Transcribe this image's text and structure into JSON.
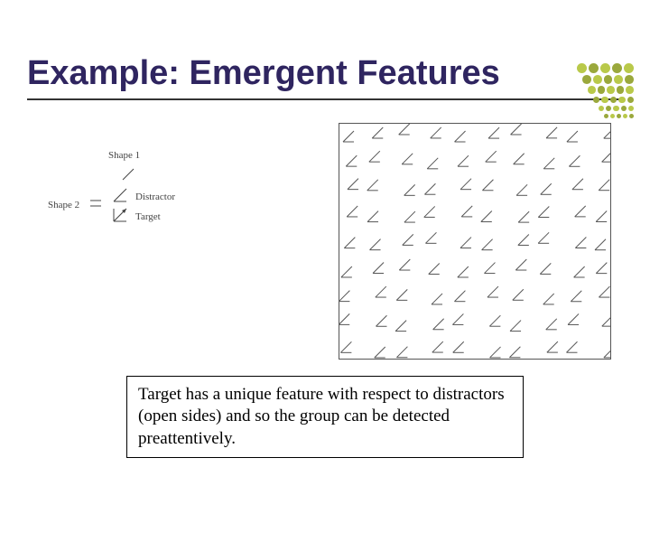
{
  "title": "Example: Emergent Features",
  "legend": {
    "shape1": "Shape 1",
    "shape2": "Shape 2",
    "distractor": "Distractor",
    "target": "Target"
  },
  "caption": "Target has a unique feature with respect to distractors (open sides) and so the group can be detected preattentively.",
  "palette": {
    "title": "#2f2560",
    "accent": "#b9c94a",
    "accent_alt": "#9aa83c"
  }
}
